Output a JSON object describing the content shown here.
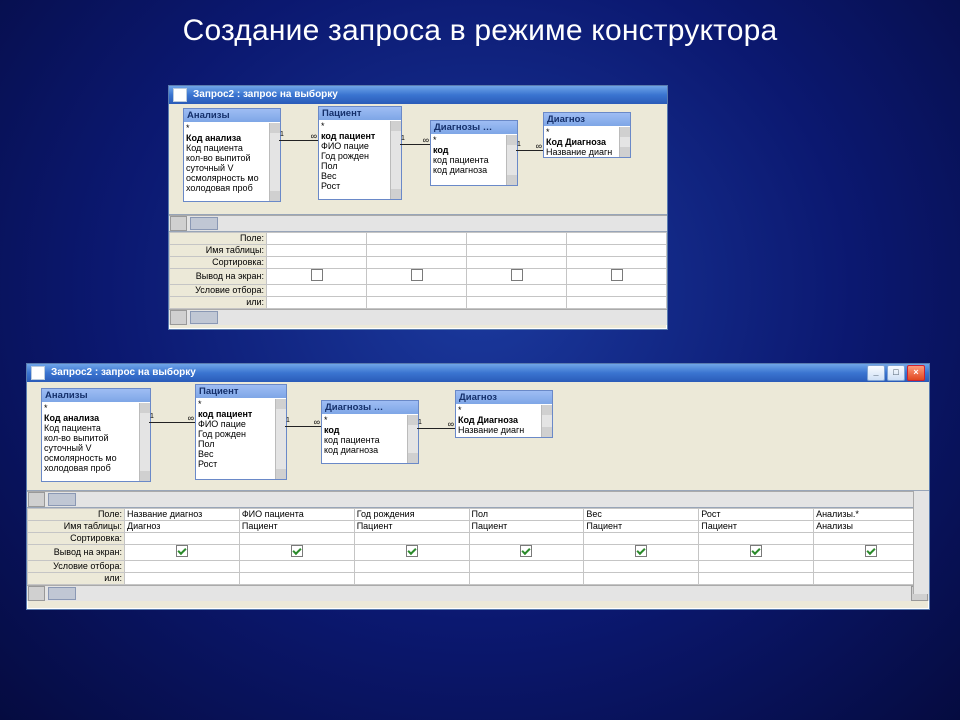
{
  "slide_title": "Создание запроса в режиме конструктора",
  "window_title": "Запрос2 : запрос на выборку",
  "tables": {
    "analizy": {
      "title": "Анализы",
      "fields": [
        "*",
        "Код анализа",
        "Код пациента",
        "кол-во выпитой",
        "суточный V",
        "осмолярность мо",
        "холодовая проб"
      ]
    },
    "patient": {
      "title": "Пациент",
      "fields": [
        "*",
        "код пациент",
        "ФИО пацие",
        "Год рожден",
        "Пол",
        "Вес",
        "Рост"
      ]
    },
    "diagnozy": {
      "title": "Диагнозы …",
      "fields": [
        "*",
        "код",
        "код пациента",
        "код диагноза"
      ]
    },
    "diagnoz": {
      "title": "Диагноз",
      "fields": [
        "*",
        "Код Диагноза",
        "Название диагн"
      ]
    }
  },
  "grid_rows": [
    "Поле:",
    "Имя таблицы:",
    "Сортировка:",
    "Вывод на экран:",
    "Условие отбора:",
    "или:"
  ],
  "top_grid_cols": 4,
  "bottom_grid": {
    "field": [
      "Название диагноз",
      "ФИО пациента",
      "Год рождения",
      "Пол",
      "Вес",
      "Рост",
      "Анализы.*"
    ],
    "table": [
      "Диагноз",
      "Пациент",
      "Пациент",
      "Пациент",
      "Пациент",
      "Пациент",
      "Анализы"
    ],
    "show": [
      true,
      true,
      true,
      true,
      true,
      true,
      true
    ]
  }
}
